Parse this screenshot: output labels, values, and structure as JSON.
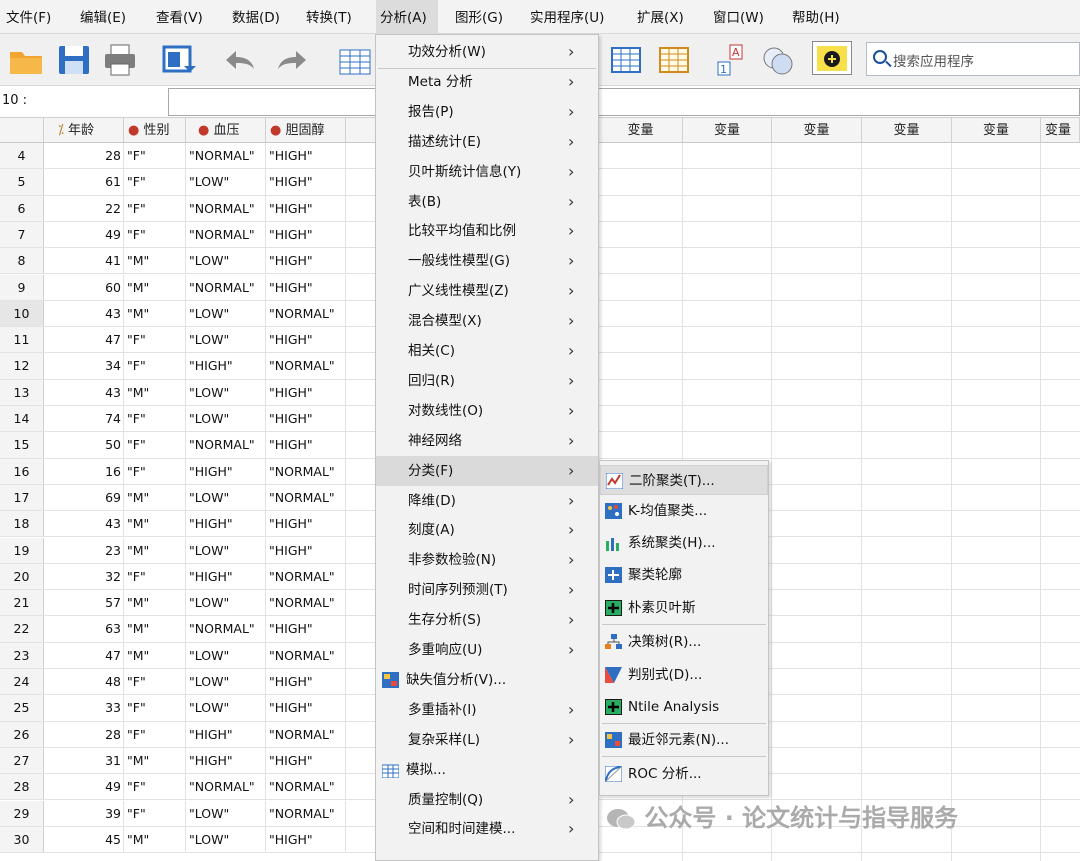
{
  "menubar": [
    "文件(F)",
    "编辑(E)",
    "查看(V)",
    "数据(D)",
    "转换(T)",
    "分析(A)",
    "图形(G)",
    "实用程序(U)",
    "扩展(X)",
    "窗口(W)",
    "帮助(H)"
  ],
  "search": {
    "placeholder": "搜索应用程序"
  },
  "cell_ref": "10 :",
  "columns": [
    "年龄",
    "性别",
    "血压",
    "胆固醇"
  ],
  "var_header": "变量",
  "rows": [
    {
      "n": "4",
      "age": "28",
      "sex": "\"F\"",
      "bp": "\"NORMAL\"",
      "chol": "\"HIGH\""
    },
    {
      "n": "5",
      "age": "61",
      "sex": "\"F\"",
      "bp": "\"LOW\"",
      "chol": "\"HIGH\""
    },
    {
      "n": "6",
      "age": "22",
      "sex": "\"F\"",
      "bp": "\"NORMAL\"",
      "chol": "\"HIGH\""
    },
    {
      "n": "7",
      "age": "49",
      "sex": "\"F\"",
      "bp": "\"NORMAL\"",
      "chol": "\"HIGH\""
    },
    {
      "n": "8",
      "age": "41",
      "sex": "\"M\"",
      "bp": "\"LOW\"",
      "chol": "\"HIGH\""
    },
    {
      "n": "9",
      "age": "60",
      "sex": "\"M\"",
      "bp": "\"NORMAL\"",
      "chol": "\"HIGH\""
    },
    {
      "n": "10",
      "age": "43",
      "sex": "\"M\"",
      "bp": "\"LOW\"",
      "chol": "\"NORMAL\""
    },
    {
      "n": "11",
      "age": "47",
      "sex": "\"F\"",
      "bp": "\"LOW\"",
      "chol": "\"HIGH\""
    },
    {
      "n": "12",
      "age": "34",
      "sex": "\"F\"",
      "bp": "\"HIGH\"",
      "chol": "\"NORMAL\""
    },
    {
      "n": "13",
      "age": "43",
      "sex": "\"M\"",
      "bp": "\"LOW\"",
      "chol": "\"HIGH\""
    },
    {
      "n": "14",
      "age": "74",
      "sex": "\"F\"",
      "bp": "\"LOW\"",
      "chol": "\"HIGH\""
    },
    {
      "n": "15",
      "age": "50",
      "sex": "\"F\"",
      "bp": "\"NORMAL\"",
      "chol": "\"HIGH\""
    },
    {
      "n": "16",
      "age": "16",
      "sex": "\"F\"",
      "bp": "\"HIGH\"",
      "chol": "\"NORMAL\""
    },
    {
      "n": "17",
      "age": "69",
      "sex": "\"M\"",
      "bp": "\"LOW\"",
      "chol": "\"NORMAL\""
    },
    {
      "n": "18",
      "age": "43",
      "sex": "\"M\"",
      "bp": "\"HIGH\"",
      "chol": "\"HIGH\""
    },
    {
      "n": "19",
      "age": "23",
      "sex": "\"M\"",
      "bp": "\"LOW\"",
      "chol": "\"HIGH\""
    },
    {
      "n": "20",
      "age": "32",
      "sex": "\"F\"",
      "bp": "\"HIGH\"",
      "chol": "\"NORMAL\""
    },
    {
      "n": "21",
      "age": "57",
      "sex": "\"M\"",
      "bp": "\"LOW\"",
      "chol": "\"NORMAL\""
    },
    {
      "n": "22",
      "age": "63",
      "sex": "\"M\"",
      "bp": "\"NORMAL\"",
      "chol": "\"HIGH\""
    },
    {
      "n": "23",
      "age": "47",
      "sex": "\"M\"",
      "bp": "\"LOW\"",
      "chol": "\"NORMAL\""
    },
    {
      "n": "24",
      "age": "48",
      "sex": "\"F\"",
      "bp": "\"LOW\"",
      "chol": "\"HIGH\""
    },
    {
      "n": "25",
      "age": "33",
      "sex": "\"F\"",
      "bp": "\"LOW\"",
      "chol": "\"HIGH\""
    },
    {
      "n": "26",
      "age": "28",
      "sex": "\"F\"",
      "bp": "\"HIGH\"",
      "chol": "\"NORMAL\""
    },
    {
      "n": "27",
      "age": "31",
      "sex": "\"M\"",
      "bp": "\"HIGH\"",
      "chol": "\"HIGH\""
    },
    {
      "n": "28",
      "age": "49",
      "sex": "\"F\"",
      "bp": "\"NORMAL\"",
      "chol": "\"NORMAL\""
    },
    {
      "n": "29",
      "age": "39",
      "sex": "\"F\"",
      "bp": "\"LOW\"",
      "chol": "\"NORMAL\""
    },
    {
      "n": "30",
      "age": "45",
      "sex": "\"M\"",
      "bp": "\"LOW\"",
      "chol": "\"HIGH\""
    }
  ],
  "analyze_menu": [
    {
      "label": "功效分析(W)",
      "sub": true
    },
    {
      "label": "Meta 分析",
      "sub": true
    },
    {
      "label": "报告(P)",
      "sub": true
    },
    {
      "label": "描述统计(E)",
      "sub": true
    },
    {
      "label": "贝叶斯统计信息(Y)",
      "sub": true
    },
    {
      "label": "表(B)",
      "sub": true
    },
    {
      "label": "比较平均值和比例",
      "sub": true
    },
    {
      "label": "一般线性模型(G)",
      "sub": true
    },
    {
      "label": "广义线性模型(Z)",
      "sub": true
    },
    {
      "label": "混合模型(X)",
      "sub": true
    },
    {
      "label": "相关(C)",
      "sub": true
    },
    {
      "label": "回归(R)",
      "sub": true
    },
    {
      "label": "对数线性(O)",
      "sub": true
    },
    {
      "label": "神经网络",
      "sub": true
    },
    {
      "label": "分类(F)",
      "sub": true,
      "highlighted": true
    },
    {
      "label": "降维(D)",
      "sub": true
    },
    {
      "label": "刻度(A)",
      "sub": true
    },
    {
      "label": "非参数检验(N)",
      "sub": true
    },
    {
      "label": "时间序列预测(T)",
      "sub": true
    },
    {
      "label": "生存分析(S)",
      "sub": true
    },
    {
      "label": "多重响应(U)",
      "sub": true
    },
    {
      "label": "缺失值分析(V)...",
      "sub": false,
      "icon": "missing-values-icon"
    },
    {
      "label": "多重插补(I)",
      "sub": true
    },
    {
      "label": "复杂采样(L)",
      "sub": true
    },
    {
      "label": "模拟...",
      "sub": false,
      "icon": "simulation-icon"
    },
    {
      "label": "质量控制(Q)",
      "sub": true
    },
    {
      "label": "空间和时间建模...",
      "sub": true
    }
  ],
  "classify_submenu": [
    {
      "label": "二阶聚类(T)...",
      "icon": "twostep-cluster-icon",
      "highlighted": true
    },
    {
      "label": "K-均值聚类...",
      "icon": "kmeans-cluster-icon"
    },
    {
      "label": "系统聚类(H)...",
      "icon": "hierarchical-cluster-icon"
    },
    {
      "label": "聚类轮廓",
      "icon": "cluster-silhouettes-icon",
      "sep_after": false
    },
    {
      "label": "朴素贝叶斯",
      "icon": "naive-bayes-icon",
      "sep_after": true
    },
    {
      "label": "决策树(R)...",
      "icon": "decision-tree-icon"
    },
    {
      "label": "判别式(D)...",
      "icon": "discriminant-icon"
    },
    {
      "label": "Ntile Analysis",
      "icon": "ntile-icon",
      "sep_after": true
    },
    {
      "label": "最近邻元素(N)...",
      "icon": "nearest-neighbor-icon",
      "sep_after": true
    },
    {
      "label": "ROC 分析...",
      "icon": "roc-icon"
    }
  ],
  "watermark": "公众号 · 论文统计与指导服务",
  "colors": {
    "menu_bg": "#f2f2f2",
    "highlight": "#dadada",
    "grid_line": "#e2e2e2"
  }
}
